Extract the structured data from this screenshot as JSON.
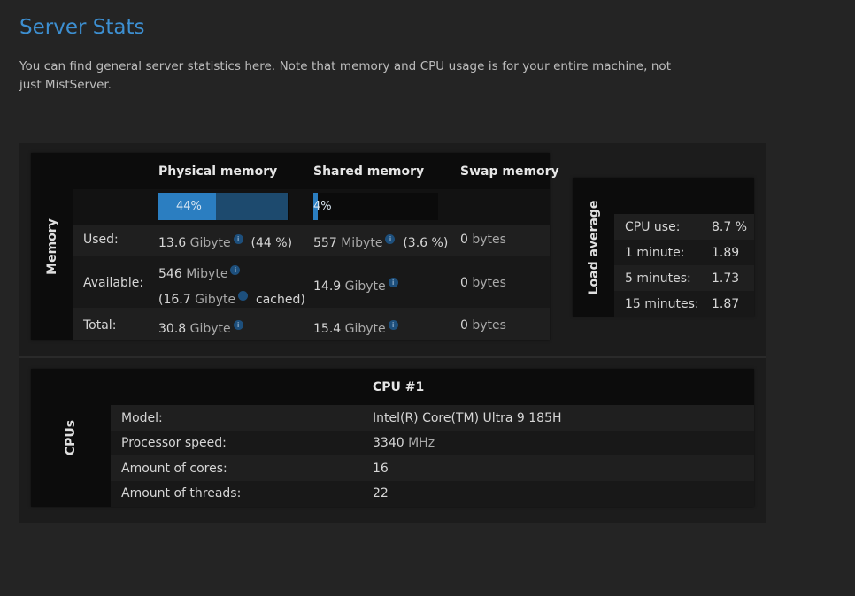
{
  "page": {
    "title": "Server Stats",
    "description": "You can find general server statistics here. Note that memory and CPU usage is for your entire machine, not just MistServer."
  },
  "memory": {
    "section_label": "Memory",
    "columns": [
      "Physical memory",
      "Shared memory",
      "Swap memory"
    ],
    "physical_usage": {
      "fraction": 0.44,
      "label": "44%"
    },
    "shared_usage": {
      "fraction": 0.036,
      "label": "4%"
    },
    "rows": {
      "used": {
        "label": "Used:",
        "physical": {
          "value": "13.6",
          "unit": "Gibyte",
          "pct": "(44 %)"
        },
        "shared": {
          "value": "557",
          "unit": "Mibyte",
          "pct": "(3.6 %)"
        },
        "swap": {
          "value": "0",
          "unit": "bytes"
        }
      },
      "available": {
        "label": "Available:",
        "physical": {
          "value": "546",
          "unit": "Mibyte",
          "cached_open": "(16.7",
          "cached_unit": "Gibyte",
          "cached_close": "cached)"
        },
        "shared": {
          "value": "14.9",
          "unit": "Gibyte"
        },
        "swap": {
          "value": "0",
          "unit": "bytes"
        }
      },
      "total": {
        "label": "Total:",
        "physical": {
          "value": "30.8",
          "unit": "Gibyte"
        },
        "shared": {
          "value": "15.4",
          "unit": "Gibyte"
        },
        "swap": {
          "value": "0",
          "unit": "bytes"
        }
      }
    },
    "info_glyph": "i"
  },
  "load": {
    "section_label": "Load average",
    "rows": [
      {
        "label": "CPU use:",
        "value": "8.7 %"
      },
      {
        "label": "1 minute:",
        "value": "1.89"
      },
      {
        "label": "5 minutes:",
        "value": "1.73"
      },
      {
        "label": "15 minutes:",
        "value": "1.87"
      }
    ]
  },
  "cpus": {
    "section_label": "CPUs",
    "header": "CPU #1",
    "rows": [
      {
        "label": "Model:",
        "value": "Intel(R) Core(TM) Ultra 9 185H",
        "unit": ""
      },
      {
        "label": "Processor speed:",
        "value": "3340",
        "unit": "MHz"
      },
      {
        "label": "Amount of cores:",
        "value": "16",
        "unit": ""
      },
      {
        "label": "Amount of threads:",
        "value": "22",
        "unit": ""
      }
    ]
  }
}
